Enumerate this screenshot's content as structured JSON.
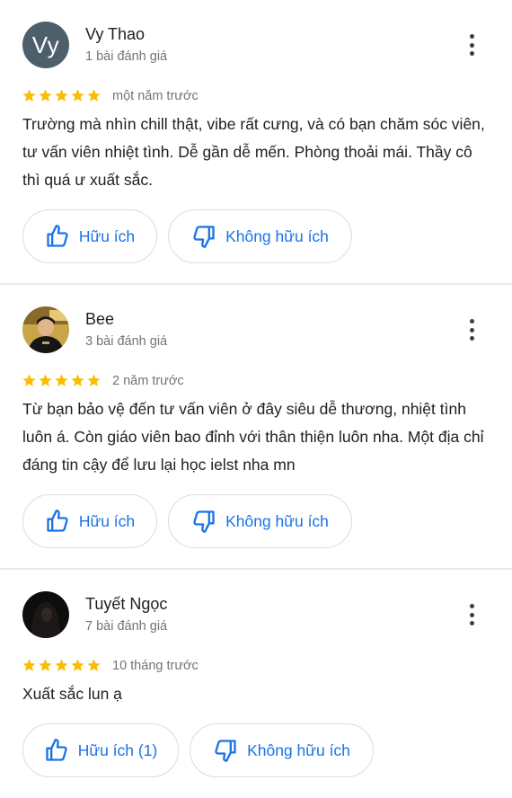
{
  "reviews": [
    {
      "avatar_initials": "Vy",
      "name": "Vy Thao",
      "count": "1 bài đánh giá",
      "rating": 5,
      "time": "một năm trước",
      "text": "Trường mà nhìn chill thật, vibe rất cưng, và có bạn chăm sóc viên, tư vấn viên nhiệt tình. Dễ gần dễ mến. Phòng thoải mái. Thầy cô thì quá ư xuất sắc.",
      "helpful_label": "Hữu ích",
      "not_helpful_label": "Không hữu ích"
    },
    {
      "name": "Bee",
      "count": "3 bài đánh giá",
      "rating": 5,
      "time": "2 năm trước",
      "text": "Từ bạn bảo vệ đến tư vấn viên ở đây siêu dễ thương, nhiệt tình luôn á. Còn giáo viên bao đỉnh với thân thiện luôn nha. Một địa chỉ đáng tin cậy để lưu lại học ielst nha mn",
      "helpful_label": "Hữu ích",
      "not_helpful_label": "Không hữu ích"
    },
    {
      "name": "Tuyết Ngọc",
      "count": "7 bài đánh giá",
      "rating": 5,
      "time": "10 tháng trước",
      "text": "Xuất sắc lun ạ",
      "helpful_label": "Hữu ích (1)",
      "not_helpful_label": "Không hữu ích"
    }
  ],
  "colors": {
    "star": "#fbbc04",
    "accent": "#1a73e8",
    "avatar_bg": "#4d5f6b"
  },
  "icons": [
    "more-vert-icon",
    "thumb-up-icon",
    "thumb-down-icon",
    "star-icon"
  ]
}
